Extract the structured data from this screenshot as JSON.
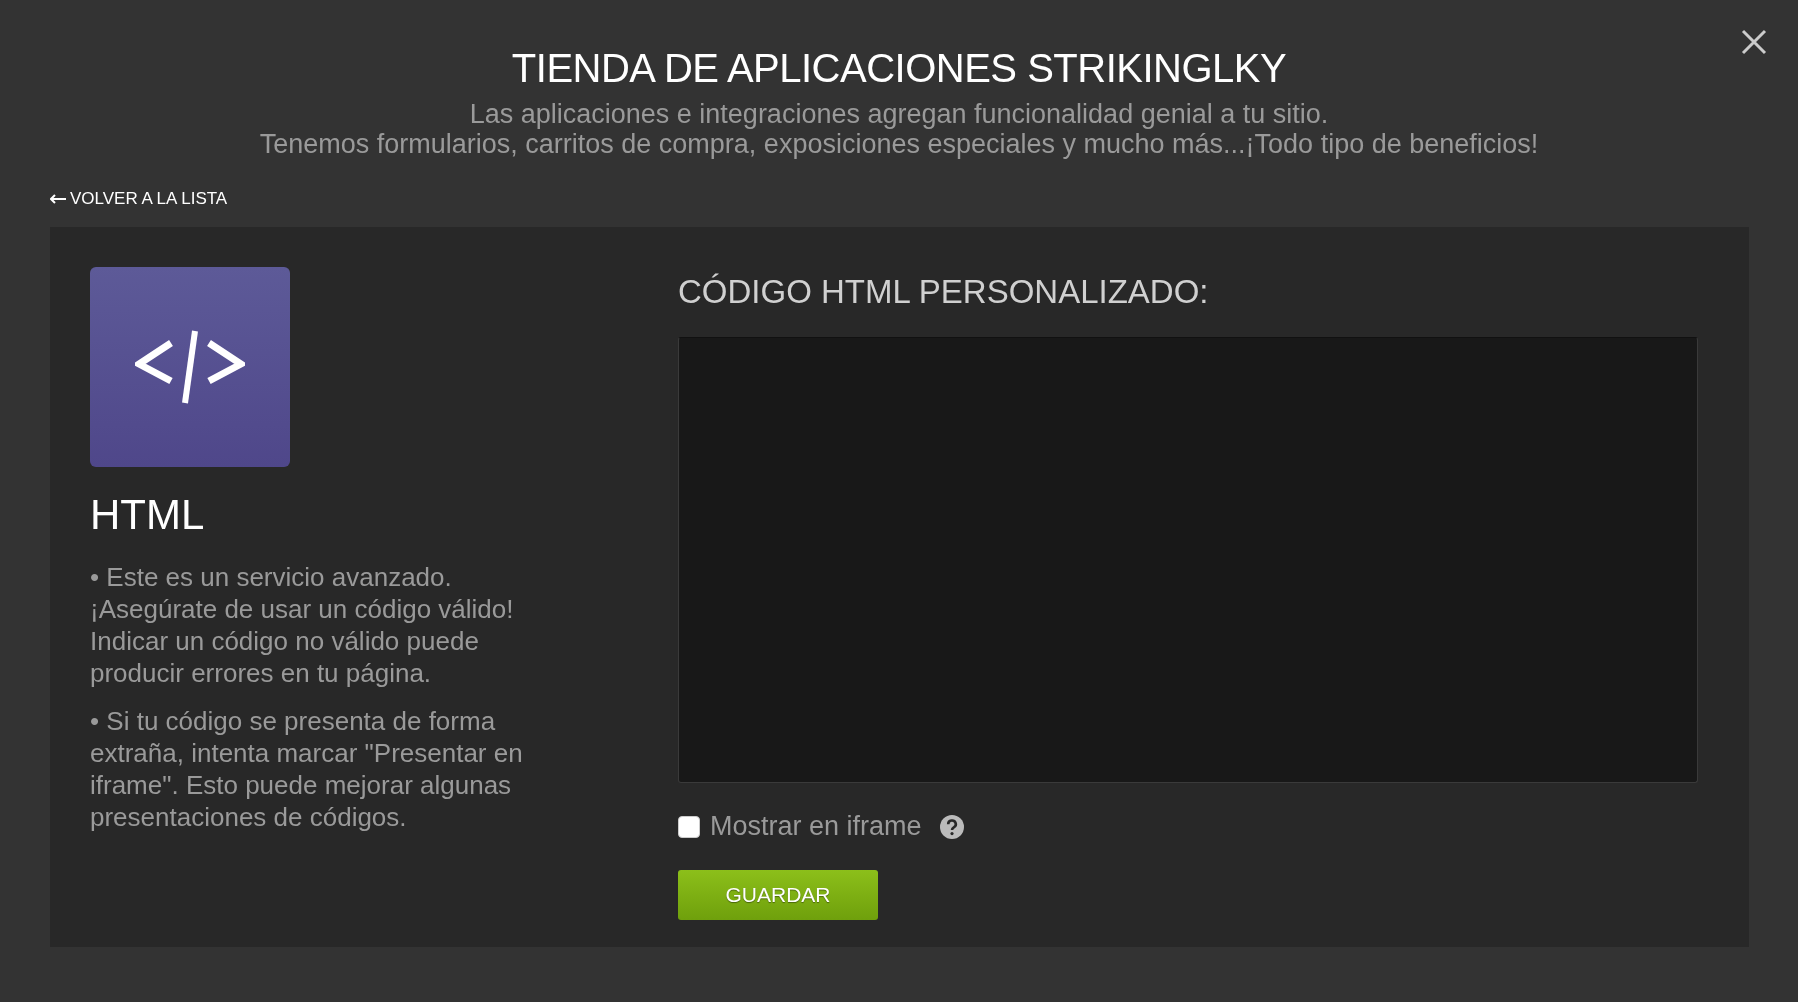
{
  "dialog": {
    "title": "TIENDA DE APLICACIONES STRIKINGLKY",
    "subtitle_lines": [
      "Las aplicaciones e integraciones agregan funcionalidad genial a tu sitio.",
      "Tenemos formularios, carritos de compra, exposiciones especiales y mucho más...¡Todo tipo de beneficios!"
    ],
    "back_link": "VOLVER A LA LISTA"
  },
  "app": {
    "name": "HTML",
    "notes": [
      "•  Este es un servicio avanzado. ¡Asegúrate de usar un código válido! Indicar un código no válido puede producir errores en tu página.",
      "•  Si tu código se presenta de forma extraña, intenta marcar \"Presentar en iframe\". Esto puede mejorar algunas presentaciones de códigos."
    ]
  },
  "editor": {
    "heading": "CÓDIGO HTML PERSONALIZADO:",
    "iframe_option": {
      "label": "Mostrar en iframe",
      "checked": false
    },
    "save_button": "GUARDAR"
  }
}
